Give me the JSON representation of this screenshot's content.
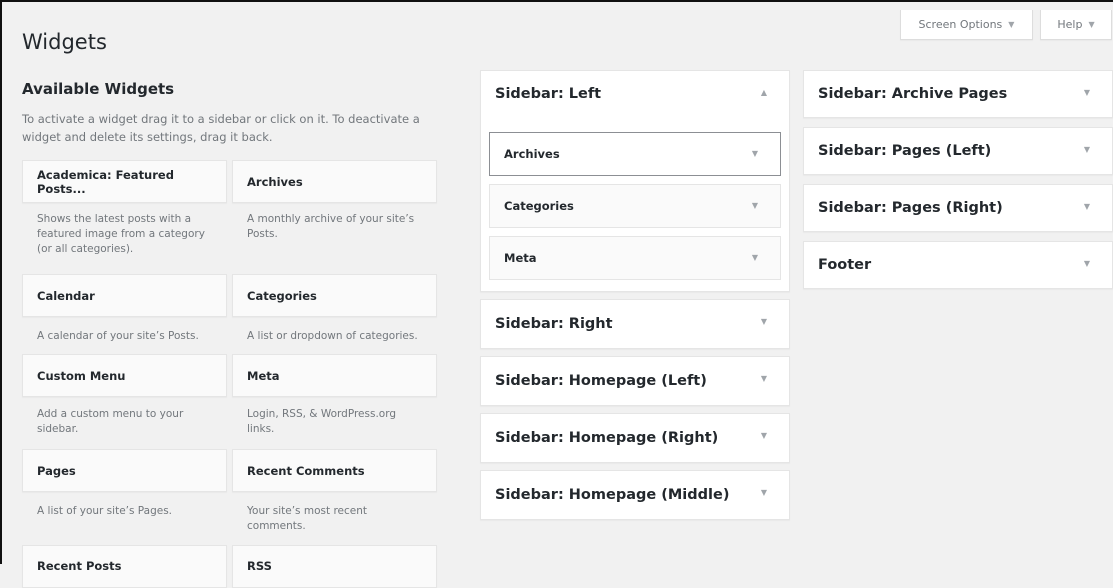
{
  "page": {
    "title": "Widgets"
  },
  "header": {
    "screen_options": "Screen Options",
    "help": "Help"
  },
  "available": {
    "title": "Available Widgets",
    "description": "To activate a widget drag it to a sidebar or click on it. To deactivate a widget and delete its settings, drag it back.",
    "widgets": [
      {
        "title": "Academica: Featured Posts...",
        "desc": "Shows the latest posts with a featured image from a category (or all categories)."
      },
      {
        "title": "Archives",
        "desc": "A monthly archive of your site’s Posts."
      },
      {
        "title": "Calendar",
        "desc": "A calendar of your site’s Posts."
      },
      {
        "title": "Categories",
        "desc": "A list or dropdown of categories."
      },
      {
        "title": "Custom Menu",
        "desc": "Add a custom menu to your sidebar."
      },
      {
        "title": "Meta",
        "desc": "Login, RSS, & WordPress.org links."
      },
      {
        "title": "Pages",
        "desc": "A list of your site’s Pages."
      },
      {
        "title": "Recent Comments",
        "desc": "Your site’s most recent comments."
      },
      {
        "title": "Recent Posts",
        "desc": ""
      },
      {
        "title": "RSS",
        "desc": ""
      }
    ]
  },
  "sidebar_left": {
    "title": "Sidebar: Left",
    "widgets": [
      "Archives",
      "Categories",
      "Meta"
    ]
  },
  "sidebars_col2": [
    "Sidebar: Right",
    "Sidebar: Homepage (Left)",
    "Sidebar: Homepage (Right)",
    "Sidebar: Homepage (Middle)"
  ],
  "sidebars_col3": [
    "Sidebar: Archive Pages",
    "Sidebar: Pages (Left)",
    "Sidebar: Pages (Right)",
    "Footer"
  ],
  "icons": {
    "expand": "▼",
    "collapse": "▲"
  }
}
